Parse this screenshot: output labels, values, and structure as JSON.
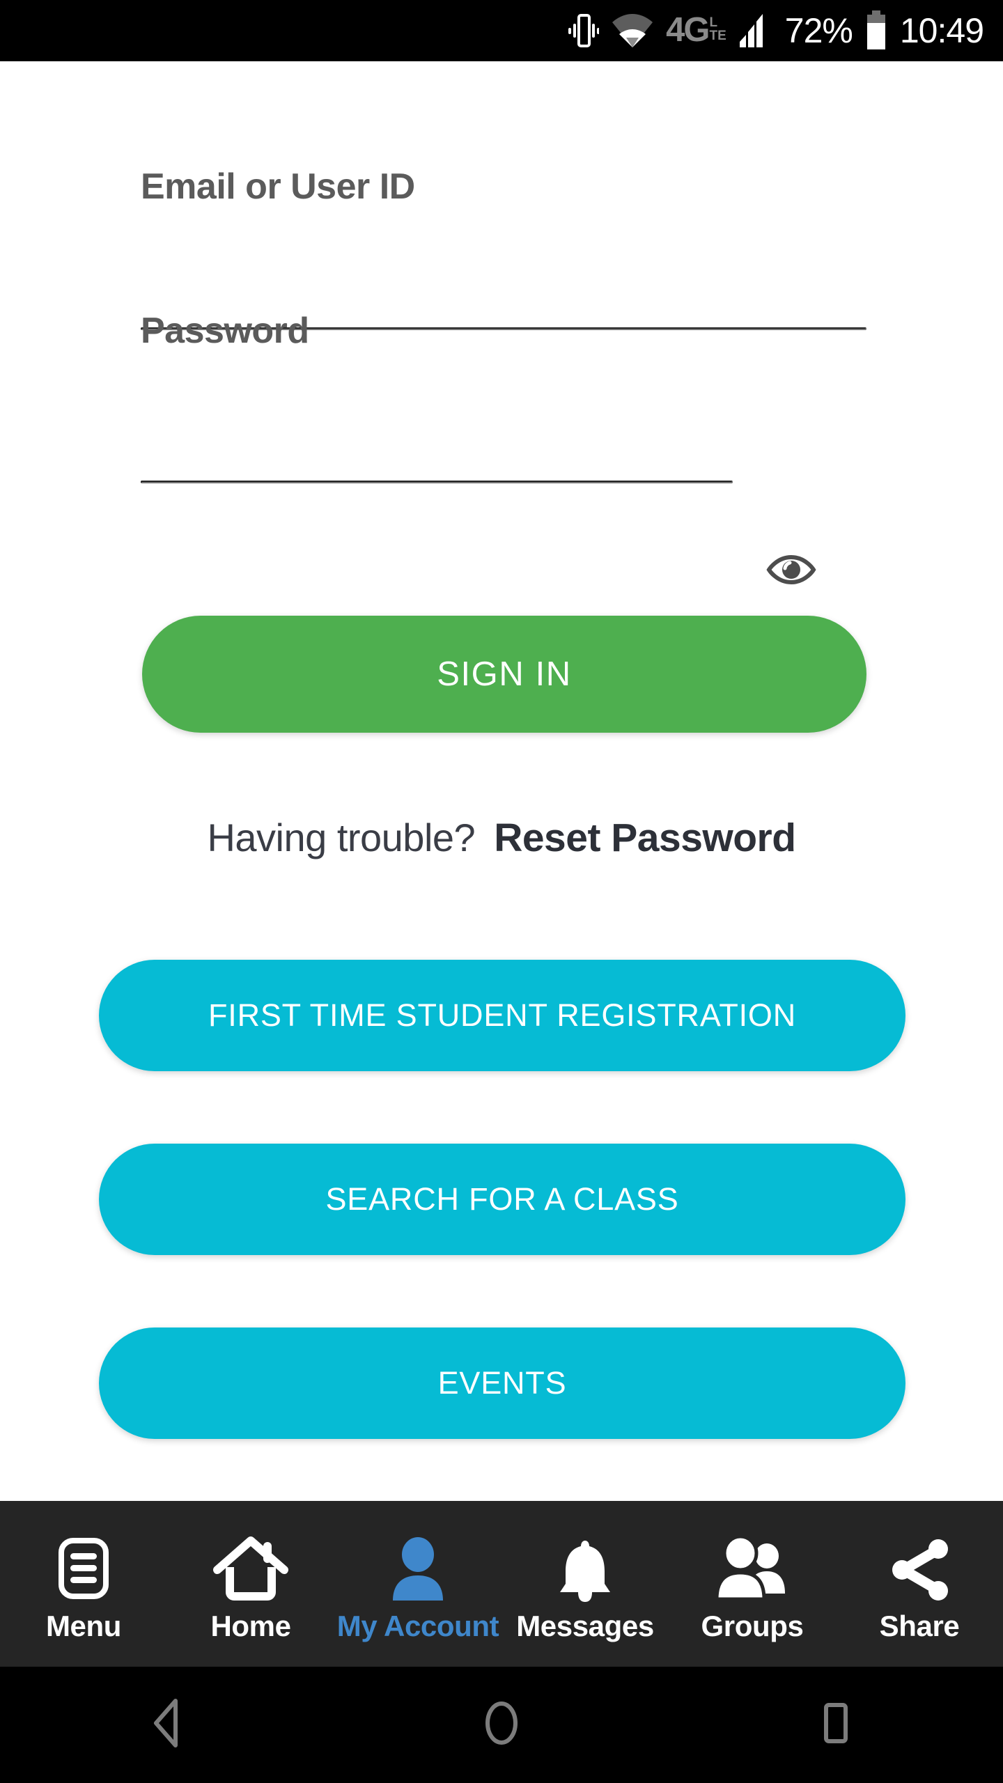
{
  "statusbar": {
    "vibrate_icon": "vibrate-icon",
    "wifi_icon": "wifi-icon",
    "network_main": "4G",
    "network_sub_top": "L",
    "network_sub_bottom": "TE",
    "network_label": "4G LTE",
    "signal_icon": "signal-bars-icon",
    "battery_percent": "72%",
    "battery_icon": "battery-icon",
    "time": "10:49"
  },
  "form": {
    "email": {
      "label": "Email or User ID",
      "value": "",
      "placeholder": ""
    },
    "password": {
      "label": "Password",
      "value": "",
      "placeholder": "",
      "toggle_icon": "eye-icon"
    },
    "signin_label": "SIGN IN",
    "trouble_text": "Having trouble?",
    "reset_label": "Reset Password"
  },
  "actions": [
    {
      "label": "FIRST TIME STUDENT REGISTRATION",
      "name": "first-time-student-registration-button"
    },
    {
      "label": "SEARCH FOR A CLASS",
      "name": "search-for-a-class-button"
    },
    {
      "label": "EVENTS",
      "name": "events-button"
    }
  ],
  "bottom_nav": {
    "items": [
      {
        "label": "Menu",
        "icon": "menu-icon",
        "active": false
      },
      {
        "label": "Home",
        "icon": "home-icon",
        "active": false
      },
      {
        "label": "My Account",
        "icon": "person-icon",
        "active": true
      },
      {
        "label": "Messages",
        "icon": "bell-icon",
        "active": false
      },
      {
        "label": "Groups",
        "icon": "groups-icon",
        "active": false
      },
      {
        "label": "Share",
        "icon": "share-icon",
        "active": false
      }
    ]
  },
  "system_nav": {
    "back": "back-triangle-icon",
    "home": "home-circle-icon",
    "recents": "recents-square-icon"
  },
  "colors": {
    "signin_green": "#4EAF4F",
    "action_cyan": "#06BBD4",
    "active_blue": "#3F87CB",
    "nav_background": "#252525",
    "status_background": "#000000",
    "label_gray": "#5b5b5b",
    "line_gray": "#d4d4d4"
  }
}
